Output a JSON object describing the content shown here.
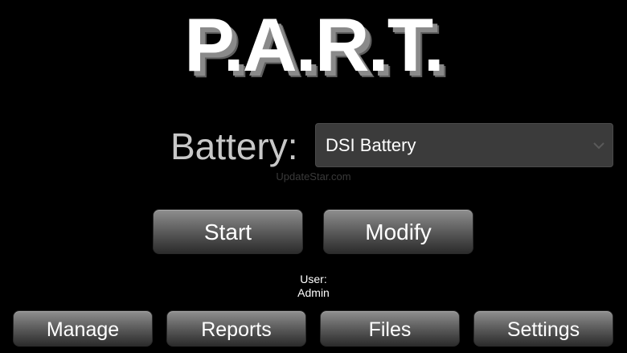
{
  "app": {
    "title": "P.A.R.T."
  },
  "battery": {
    "label": "Battery:",
    "selected": "DSI Battery"
  },
  "watermark": "UpdateStar.com",
  "actions": {
    "start_label": "Start",
    "modify_label": "Modify"
  },
  "user": {
    "label": "User:",
    "name": "Admin"
  },
  "nav": {
    "manage_label": "Manage",
    "reports_label": "Reports",
    "files_label": "Files",
    "settings_label": "Settings"
  },
  "icons": {
    "dropdown": "chevron-down-icon"
  },
  "colors": {
    "background": "#000000",
    "button_top": "#8f8f8f",
    "button_bottom": "#2c2c2c",
    "select_bg": "#3b3b3b",
    "label_gray": "#c8c8c8"
  }
}
